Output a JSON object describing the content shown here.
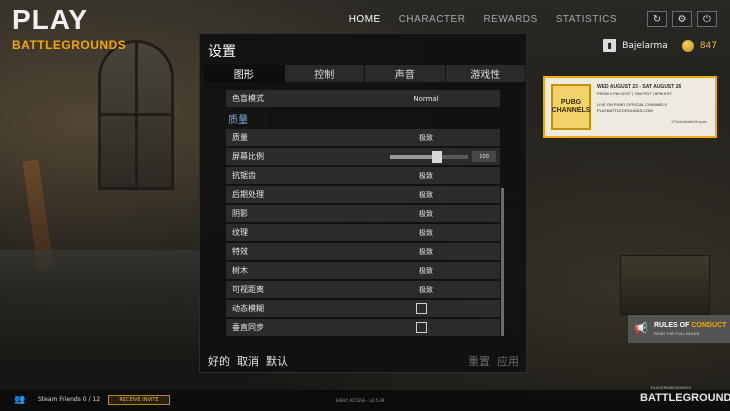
{
  "logo": {
    "play": "PLAY",
    "subtitle": "BATTLEGROUNDS"
  },
  "nav": {
    "items": [
      "HOME",
      "CHARACTER",
      "REWARDS",
      "STATISTICS"
    ],
    "active": "HOME"
  },
  "user": {
    "name": "Bajelarma",
    "coins": "847"
  },
  "banner": {
    "logo_text": "PUBG CHANNELS",
    "date": "WED AUGUST 23 - SAT AUGUST 26",
    "time": "FROM 4 PM CEST | 7AM PDT | 8PM KST",
    "live": "LIVE ON PUBG OFFICIAL CHANNELS",
    "url": "PLAYBATTLEGROUNDS.COM",
    "tag": "#ThisIsBattleRoyale"
  },
  "settings": {
    "title": "设置",
    "tabs": [
      "图形",
      "控制",
      "声音",
      "游戏性"
    ],
    "active_tab": "图形",
    "colorblind": {
      "label": "色盲模式",
      "value": "Normal"
    },
    "section_quality": "质量",
    "rows": [
      {
        "label": "质量",
        "value": "极致"
      },
      {
        "label": "屏幕比例",
        "slider_value": "100",
        "slider_fraction": 0.6
      },
      {
        "label": "抗锯齿",
        "value": "极致"
      },
      {
        "label": "后期处理",
        "value": "极致"
      },
      {
        "label": "阴影",
        "value": "极致"
      },
      {
        "label": "纹理",
        "value": "极致"
      },
      {
        "label": "特效",
        "value": "极致"
      },
      {
        "label": "树木",
        "value": "极致"
      },
      {
        "label": "可视距离",
        "value": "极致"
      },
      {
        "label": "动态模糊",
        "checked": false
      },
      {
        "label": "垂直同步",
        "checked": false
      }
    ],
    "footer_left": [
      "好的",
      "取消",
      "默认"
    ],
    "footer_right": [
      "重置",
      "应用"
    ]
  },
  "rules": {
    "title_a": "RULES OF ",
    "title_b": "CONDUCT",
    "sub": "READ THE FULL RULES"
  },
  "bottom": {
    "friends": "Steam Friends 0 / 12",
    "receive_invite": "RECEIVE INVITE",
    "version": "EARLY ACCESS - v2.5.39",
    "logo_top": "PLAYERUNKNOWN'S",
    "logo": "BATTLEGROUNDS"
  }
}
